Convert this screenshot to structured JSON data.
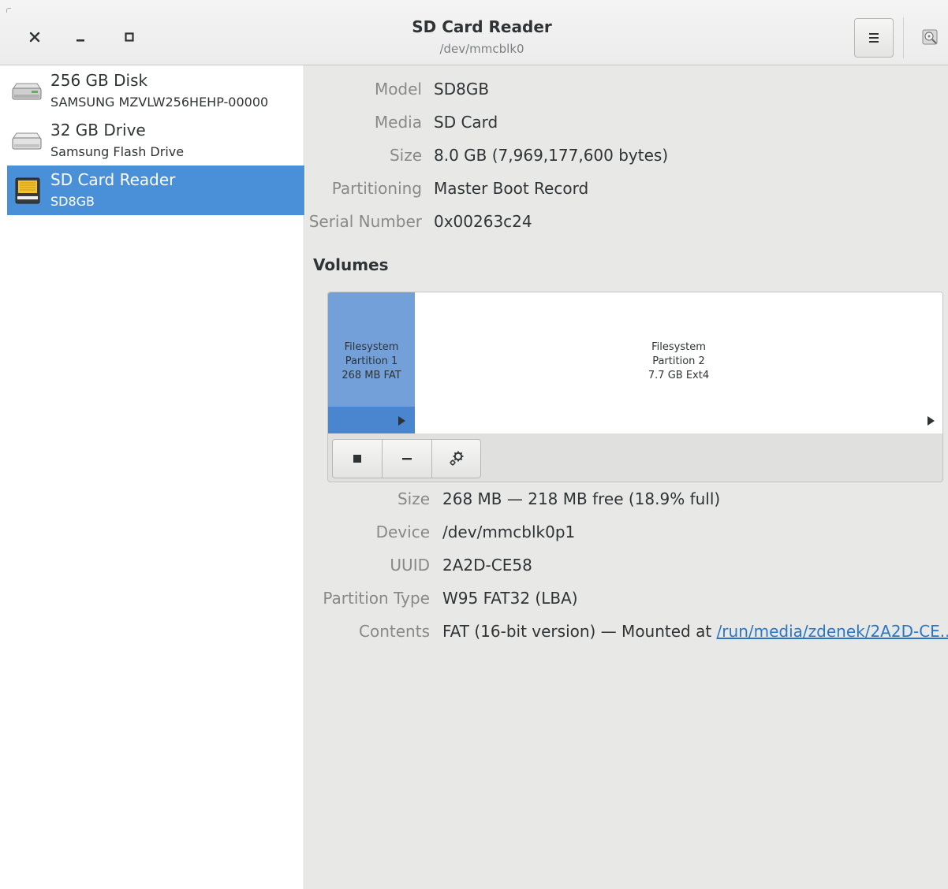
{
  "window": {
    "title": "SD Card Reader",
    "subtitle": "/dev/mmcblk0",
    "controls": {
      "close_icon": "close-icon",
      "minimize_icon": "minimize-icon",
      "maximize_icon": "maximize-icon"
    },
    "menu_icon": "hamburger-menu-icon",
    "disk_image_icon": "disk-image-icon"
  },
  "sidebar": {
    "drives": [
      {
        "name": "256 GB Disk",
        "detail": "SAMSUNG MZVLW256HEHP-00000",
        "icon": "hard-disk-icon",
        "selected": false
      },
      {
        "name": "32 GB Drive",
        "detail": "Samsung Flash Drive",
        "icon": "usb-drive-icon",
        "selected": false
      },
      {
        "name": "SD Card Reader",
        "detail": "SD8GB",
        "icon": "sd-card-icon",
        "selected": true
      }
    ]
  },
  "drive": {
    "props": [
      {
        "label": "Model",
        "value": "SD8GB"
      },
      {
        "label": "Media",
        "value": "SD Card"
      },
      {
        "label": "Size",
        "value": "8.0 GB (7,969,177,600 bytes)"
      },
      {
        "label": "Partitioning",
        "value": "Master Boot Record"
      },
      {
        "label": "Serial Number",
        "value": "0x00263c24"
      }
    ]
  },
  "volumes": {
    "heading": "Volumes",
    "partitions": [
      {
        "line1": "Filesystem",
        "line2": "Partition 1",
        "line3": "268 MB FAT",
        "selected": true
      },
      {
        "line1": "Filesystem",
        "line2": "Partition 2",
        "line3": "7.7 GB Ext4",
        "selected": false
      }
    ],
    "toolbar": {
      "stop_icon": "stop-icon",
      "delete_icon": "minus-icon",
      "settings_icon": "gears-icon"
    }
  },
  "volume_props": [
    {
      "label": "Size",
      "value": "268 MB — 218 MB free (18.9% full)"
    },
    {
      "label": "Device",
      "value": "/dev/mmcblk0p1"
    },
    {
      "label": "UUID",
      "value": "2A2D-CE58"
    },
    {
      "label": "Partition Type",
      "value": "W95 FAT32 (LBA)"
    },
    {
      "label": "Contents",
      "value": "FAT (16-bit version) — Mounted at ",
      "link": "/run/media/zdenek/2A2D-CE..."
    }
  ],
  "colors": {
    "selection": "#4a90d9",
    "partition_selected": "#73a0d8",
    "link": "#2a76c6"
  }
}
